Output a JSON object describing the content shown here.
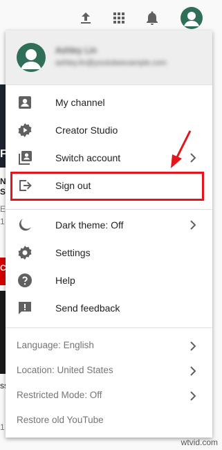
{
  "account": {
    "name": "Ashley Lin",
    "email": "ashley.lin@youtubeexample.com"
  },
  "menu": {
    "items": [
      {
        "label": "My channel"
      },
      {
        "label": "Creator Studio"
      },
      {
        "label": "Switch account"
      },
      {
        "label": "Sign out"
      },
      {
        "label": "Dark theme: Off"
      },
      {
        "label": "Settings"
      },
      {
        "label": "Help"
      },
      {
        "label": "Send feedback"
      }
    ],
    "secondary": [
      {
        "label": "Language: English"
      },
      {
        "label": "Location: United States"
      },
      {
        "label": "Restricted Mode: Off"
      },
      {
        "label": "Restore old YouTube"
      }
    ]
  },
  "background": {
    "fragments": [
      "F",
      "N:",
      "S",
      "E",
      "1",
      "CH",
      "ss",
      "1"
    ]
  },
  "watermark": "wtvid.com",
  "colors": {
    "highlight": "#e5131b",
    "avatar": "#2f6f58",
    "icon": "#606060"
  },
  "icons": [
    "upload-icon",
    "apps-icon",
    "bell-icon",
    "person-box-icon",
    "gear-play-icon",
    "switch-account-icon",
    "sign-out-icon",
    "moon-icon",
    "gear-icon",
    "help-icon",
    "feedback-icon",
    "chevron-right-icon"
  ]
}
